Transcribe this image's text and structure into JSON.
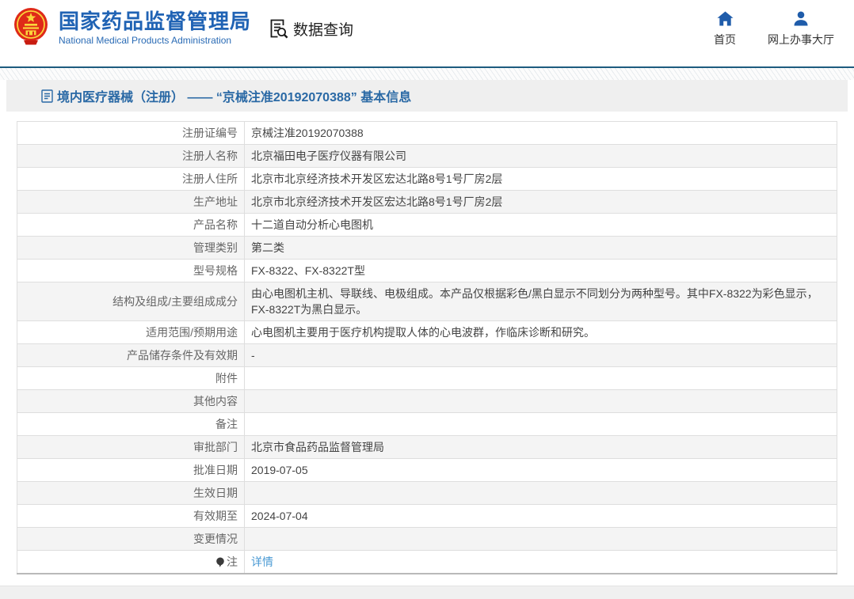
{
  "header": {
    "logo_title": "国家药品监督管理局",
    "logo_subtitle": "National Medical Products Administration",
    "section_label": "数据查询",
    "nav": [
      {
        "label": "首页",
        "icon": "home-icon"
      },
      {
        "label": "网上办事大厅",
        "icon": "user-icon"
      }
    ]
  },
  "page": {
    "title": "境内医疗器械（注册） —— “京械注准20192070388” 基本信息"
  },
  "table": {
    "rows": [
      {
        "label": "注册证编号",
        "value": "京械注准20192070388"
      },
      {
        "label": "注册人名称",
        "value": "北京福田电子医疗仪器有限公司"
      },
      {
        "label": "注册人住所",
        "value": "北京市北京经济技术开发区宏达北路8号1号厂房2层"
      },
      {
        "label": "生产地址",
        "value": "北京市北京经济技术开发区宏达北路8号1号厂房2层"
      },
      {
        "label": "产品名称",
        "value": "十二道自动分析心电图机"
      },
      {
        "label": "管理类别",
        "value": "第二类"
      },
      {
        "label": "型号规格",
        "value": "FX-8322、FX-8322T型"
      },
      {
        "label": "结构及组成/主要组成成分",
        "value": "由心电图机主机、导联线、电极组成。本产品仅根据彩色/黑白显示不同划分为两种型号。其中FX-8322为彩色显示，FX-8322T为黑白显示。"
      },
      {
        "label": "适用范围/预期用途",
        "value": "心电图机主要用于医疗机构提取人体的心电波群，作临床诊断和研究。"
      },
      {
        "label": "产品储存条件及有效期",
        "value": "-"
      },
      {
        "label": "附件",
        "value": ""
      },
      {
        "label": "其他内容",
        "value": ""
      },
      {
        "label": "备注",
        "value": ""
      },
      {
        "label": "审批部门",
        "value": "北京市食品药品监督管理局"
      },
      {
        "label": "批准日期",
        "value": "2019-07-05"
      },
      {
        "label": "生效日期",
        "value": ""
      },
      {
        "label": "有效期至",
        "value": "2024-07-04"
      },
      {
        "label": "变更情况",
        "value": ""
      },
      {
        "label": "注",
        "label_icon": "note-balloon-icon",
        "value": "详情",
        "value_type": "link"
      }
    ]
  },
  "colors": {
    "brand_blue": "#2063b4",
    "page_title_blue": "#2a69a5",
    "nav_icon_blue": "#1f5caa",
    "header_rule": "#1d5b7e",
    "link_blue": "#4a9ad4",
    "row_alt_bg": "#f4f4f4",
    "title_bar_bg": "#efefef"
  }
}
